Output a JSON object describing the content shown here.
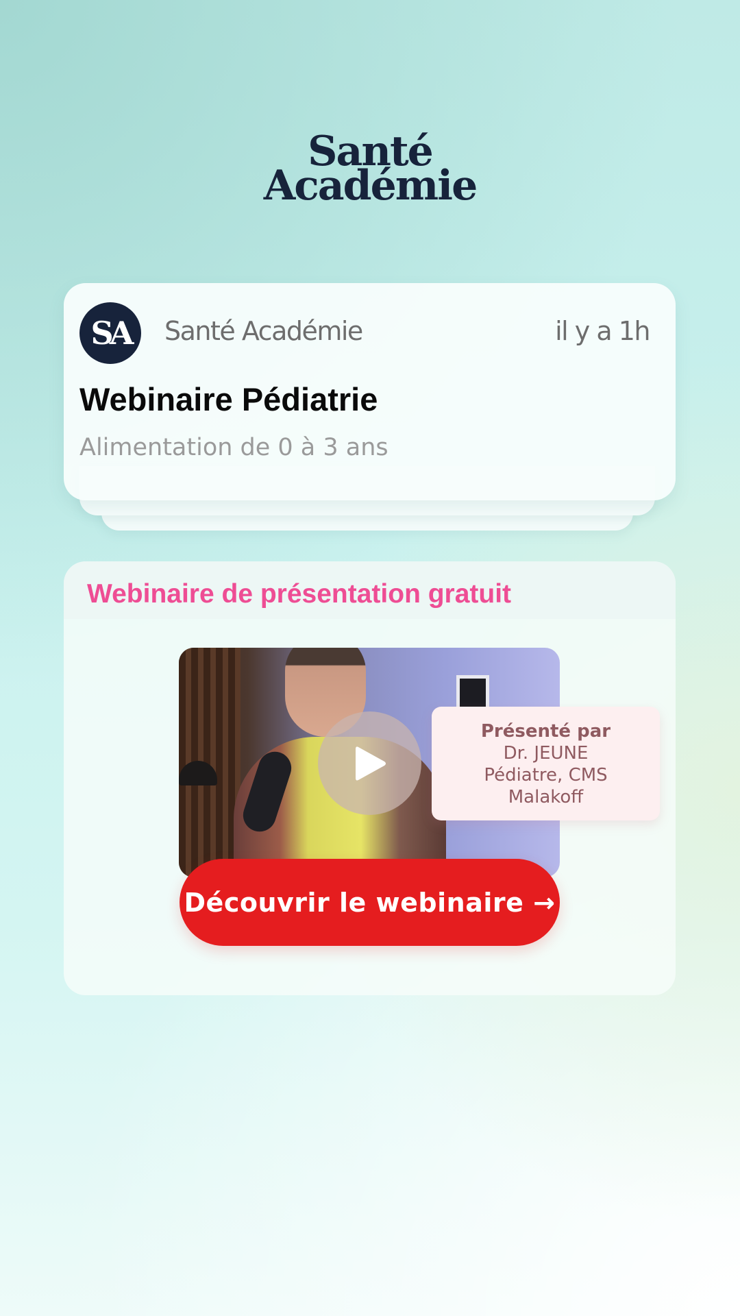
{
  "brand": {
    "logo_line1": "Santé",
    "logo_line2": "Académie",
    "logo_color": "#17233b"
  },
  "notification": {
    "avatar_text": "SA",
    "sender": "Santé Académie",
    "time": "il y a 1h",
    "title": "Webinaire Pédiatrie",
    "subtitle": "Alimentation de 0 à 3 ans"
  },
  "webinar": {
    "heading": "Webinaire de présentation gratuit",
    "heading_color": "#ee4d94",
    "presenter_label": "Présenté par",
    "presenter_name": "Dr. JEUNE",
    "presenter_role_line1": "Pédiatre, CMS",
    "presenter_role_line2": "Malakoff",
    "cta_label": "Découvrir le webinaire →",
    "cta_color": "#e51d1f",
    "play_icon": "play-icon"
  }
}
